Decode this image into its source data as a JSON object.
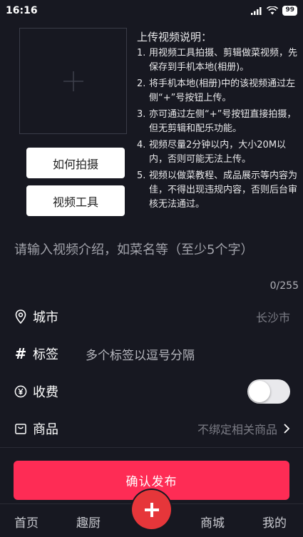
{
  "status": {
    "time": "16:16",
    "battery": "99"
  },
  "upload": {
    "how_to_shoot_label": "如何拍摄",
    "video_tool_label": "视频工具"
  },
  "instructions": {
    "title": "上传视频说明：",
    "items": [
      {
        "num": "1.",
        "text": "用视频工具拍摄、剪辑做菜视频，先保存到手机本地(相册)。"
      },
      {
        "num": "2.",
        "text": "将手机本地(相册)中的该视频通过左侧“+”号按钮上传。"
      },
      {
        "num": "3.",
        "text": "亦可通过左侧“+”号按钮直接拍摄，但无剪辑和配乐功能。"
      },
      {
        "num": "4.",
        "text": "视频尽量2分钟以内，大小20M以内，否则可能无法上传。"
      },
      {
        "num": "5.",
        "text": "视频以做菜教程、成品展示等内容为佳，不得出现违规内容，否则后台审核无法通过。"
      }
    ]
  },
  "description": {
    "placeholder": "请输入视频介绍，如菜名等（至少5个字）",
    "counter": "0/255"
  },
  "fields": {
    "city_label": "城市",
    "city_value": "长沙市",
    "tags_label": "标签",
    "tags_placeholder": "多个标签以逗号分隔",
    "charge_label": "收费",
    "charge_enabled": false,
    "goods_label": "商品",
    "goods_value": "不绑定相关商品"
  },
  "publish_label": "确认发布",
  "tabbar": {
    "home": "首页",
    "kitchen": "趣厨",
    "mall": "商城",
    "mine": "我的"
  },
  "colors": {
    "background": "#171821",
    "accent": "#fe2c55",
    "fab": "#e6363a"
  }
}
